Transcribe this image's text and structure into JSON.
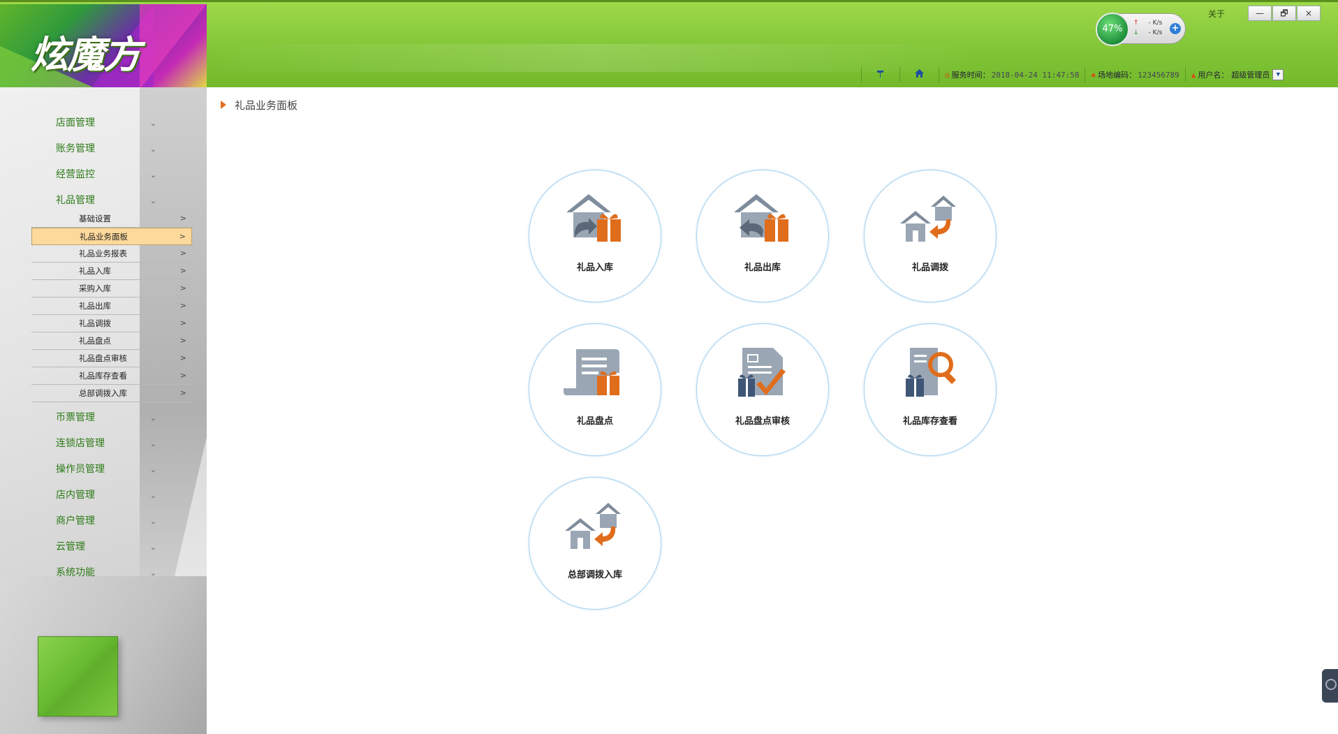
{
  "app": {
    "logo_text": "炫魔方"
  },
  "header": {
    "network": {
      "percent": "47%",
      "upload": "- K/s",
      "download": "- K/s"
    },
    "about": "关于",
    "window_controls": {
      "minimize": "—",
      "restore": "🗗",
      "close": "×"
    },
    "info": {
      "server_time_label": "服务时间：",
      "server_time": "2018-04-24 11:47:58",
      "site_code_label": "场地编码：",
      "site_code": "123456789",
      "username_label": "用户名：",
      "username": "超级管理员"
    }
  },
  "sidebar": {
    "top_items": [
      {
        "label": "店面管理"
      },
      {
        "label": "账务管理"
      },
      {
        "label": "经营监控"
      },
      {
        "label": "礼品管理"
      }
    ],
    "sub_items": [
      {
        "label": "基础设置"
      },
      {
        "label": "礼品业务面板",
        "active": true
      },
      {
        "label": "礼品业务报表"
      },
      {
        "label": "礼品入库"
      },
      {
        "label": "采购入库"
      },
      {
        "label": "礼品出库"
      },
      {
        "label": "礼品调拨"
      },
      {
        "label": "礼品盘点"
      },
      {
        "label": "礼品盘点审核"
      },
      {
        "label": "礼品库存查看"
      },
      {
        "label": "总部调拨入库"
      }
    ],
    "bottom_items": [
      {
        "label": "币票管理"
      },
      {
        "label": "连锁店管理"
      },
      {
        "label": "操作员管理"
      },
      {
        "label": "店内管理"
      },
      {
        "label": "商户管理"
      },
      {
        "label": "云管理"
      },
      {
        "label": "系统功能"
      }
    ],
    "chevron": "⌄",
    "arrow": ">"
  },
  "main": {
    "breadcrumb": "礼品业务面板",
    "tiles": [
      {
        "label": "礼品入库",
        "icon": "gift-stock-in-icon"
      },
      {
        "label": "礼品出库",
        "icon": "gift-stock-out-icon"
      },
      {
        "label": "礼品调拨",
        "icon": "gift-transfer-icon"
      },
      {
        "label": "礼品盘点",
        "icon": "gift-inventory-icon"
      },
      {
        "label": "礼品盘点审核",
        "icon": "gift-inventory-audit-icon"
      },
      {
        "label": "礼品库存查看",
        "icon": "gift-stock-search-icon"
      },
      {
        "label": "总部调拨入库",
        "icon": "hq-transfer-in-icon"
      }
    ]
  },
  "colors": {
    "header_green": "#86c93a",
    "nav_text": "#2c7a16",
    "active_sub": "#fdd99b",
    "tile_border": "#a9d3ef",
    "icon_gray": "#7f8c9c",
    "icon_orange": "#e06d1c"
  }
}
